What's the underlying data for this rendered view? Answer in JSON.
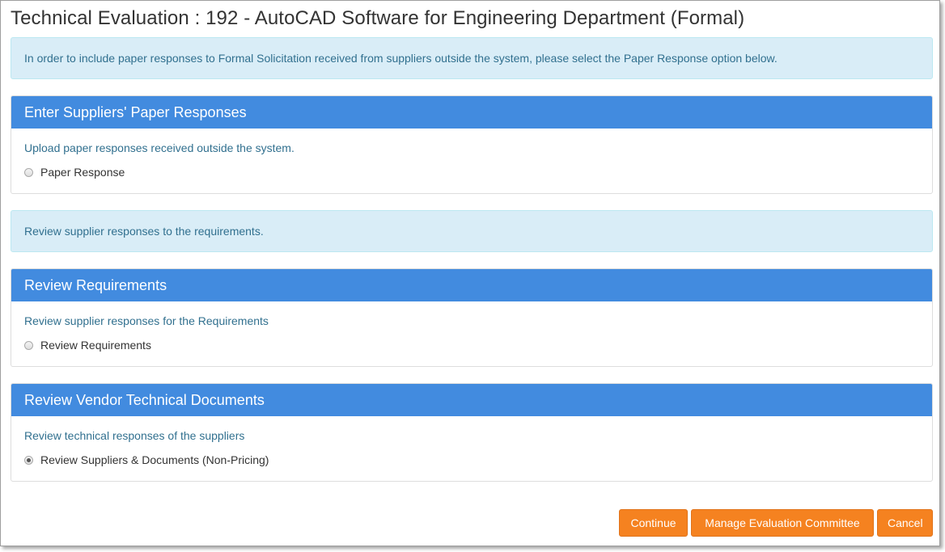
{
  "page": {
    "title": "Technical Evaluation : 192 - AutoCAD Software for Engineering Department (Formal)"
  },
  "alerts": {
    "paper_info": "In order to include paper responses to Formal Solicitation received from suppliers outside the system, please select the Paper Response option below.",
    "review_info": "Review supplier responses to the requirements."
  },
  "panels": {
    "paper": {
      "heading": "Enter Suppliers' Paper Responses",
      "description": "Upload paper responses received outside the system.",
      "option_label": "Paper Response",
      "checked": false
    },
    "requirements": {
      "heading": "Review Requirements",
      "description": "Review supplier responses for the Requirements",
      "option_label": "Review Requirements",
      "checked": false
    },
    "vendor_docs": {
      "heading": "Review Vendor Technical Documents",
      "description": "Review technical responses of the suppliers",
      "option_label": "Review Suppliers & Documents (Non-Pricing)",
      "checked": true
    }
  },
  "buttons": {
    "continue": "Continue",
    "manage_committee": "Manage Evaluation Committee",
    "cancel": "Cancel"
  },
  "colors": {
    "panel_heading": "#428bdf",
    "alert_background": "#d9edf7",
    "alert_text": "#31708f",
    "button": "#f58220"
  }
}
